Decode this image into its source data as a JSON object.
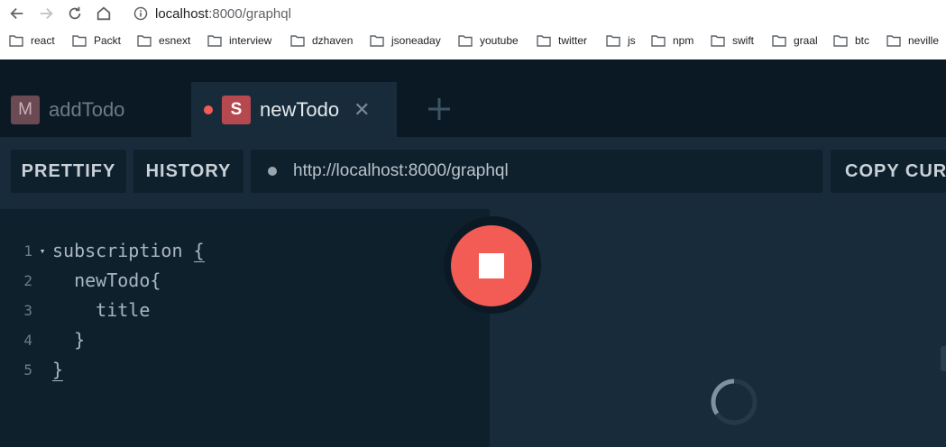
{
  "browser": {
    "url_host": "localhost",
    "url_path": ":8000/graphql",
    "bookmarks": [
      "react",
      "Packt",
      "esnext",
      "interview",
      "dzhaven",
      "jsoneaday",
      "youtube",
      "twitter",
      "js",
      "npm",
      "swift",
      "graal",
      "btc",
      "neville"
    ]
  },
  "tabs": [
    {
      "badge": "M",
      "title": "addTodo",
      "active": false
    },
    {
      "badge": "S",
      "title": "newTodo",
      "active": true
    }
  ],
  "toolbar": {
    "prettify": "PRETTIFY",
    "history": "HISTORY",
    "endpoint": "http://localhost:8000/graphql",
    "copy_curl": "COPY CURL"
  },
  "editor": {
    "lines": [
      {
        "num": "1",
        "fold": "▾",
        "code": "subscription ",
        "brace": "{"
      },
      {
        "num": "2",
        "fold": "",
        "code": "  newTodo{",
        "brace": ""
      },
      {
        "num": "3",
        "fold": "",
        "code": "    title",
        "brace": ""
      },
      {
        "num": "4",
        "fold": "",
        "code": "  }",
        "brace": ""
      },
      {
        "num": "5",
        "fold": "",
        "code": "",
        "brace": "}"
      }
    ]
  },
  "colors": {
    "accent_red": "#f25c54",
    "panel_dark": "#0f202d",
    "panel_mid": "#172b3a"
  }
}
